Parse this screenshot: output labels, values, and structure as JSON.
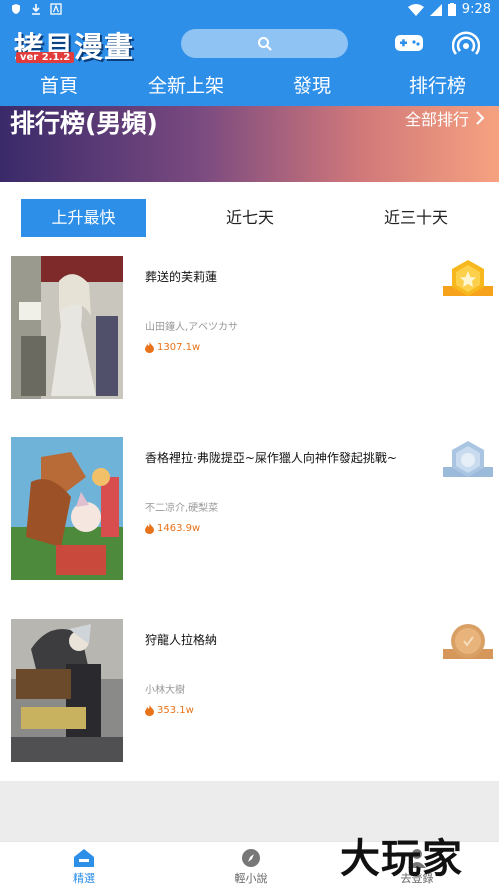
{
  "status_bar": {
    "time": "9:28"
  },
  "header": {
    "logo_text": "拷貝漫畫",
    "version": "ver 2.1.2",
    "search_placeholder": "",
    "tabs": [
      "首頁",
      "全新上架",
      "發現",
      "排行榜"
    ]
  },
  "banner": {
    "title": "排行榜(男頻)",
    "all_rankings": "全部排行"
  },
  "period_tabs": [
    "上升最快",
    "近七天",
    "近三十天"
  ],
  "items": [
    {
      "title": "葬送的芙莉蓮",
      "author": "山田鐘人,アベツカサ",
      "heat": "1307.1w",
      "rank_badge": "gold-medal-icon"
    },
    {
      "title": "香格裡拉·弗陇提亞~屎作獵人向神作發起挑戰~",
      "author": "不二凉介,硬梨菜",
      "heat": "1463.9w",
      "rank_badge": "silver-medal-icon"
    },
    {
      "title": "狩龍人拉格納",
      "author": "小林大樹",
      "heat": "353.1w",
      "rank_badge": "bronze-medal-icon"
    }
  ],
  "bottom_nav": [
    "精選",
    "輕小說",
    "去登錄"
  ],
  "watermark": "大玩家",
  "colors": {
    "primary": "#2e8fe8",
    "heat": "#e8731a"
  }
}
